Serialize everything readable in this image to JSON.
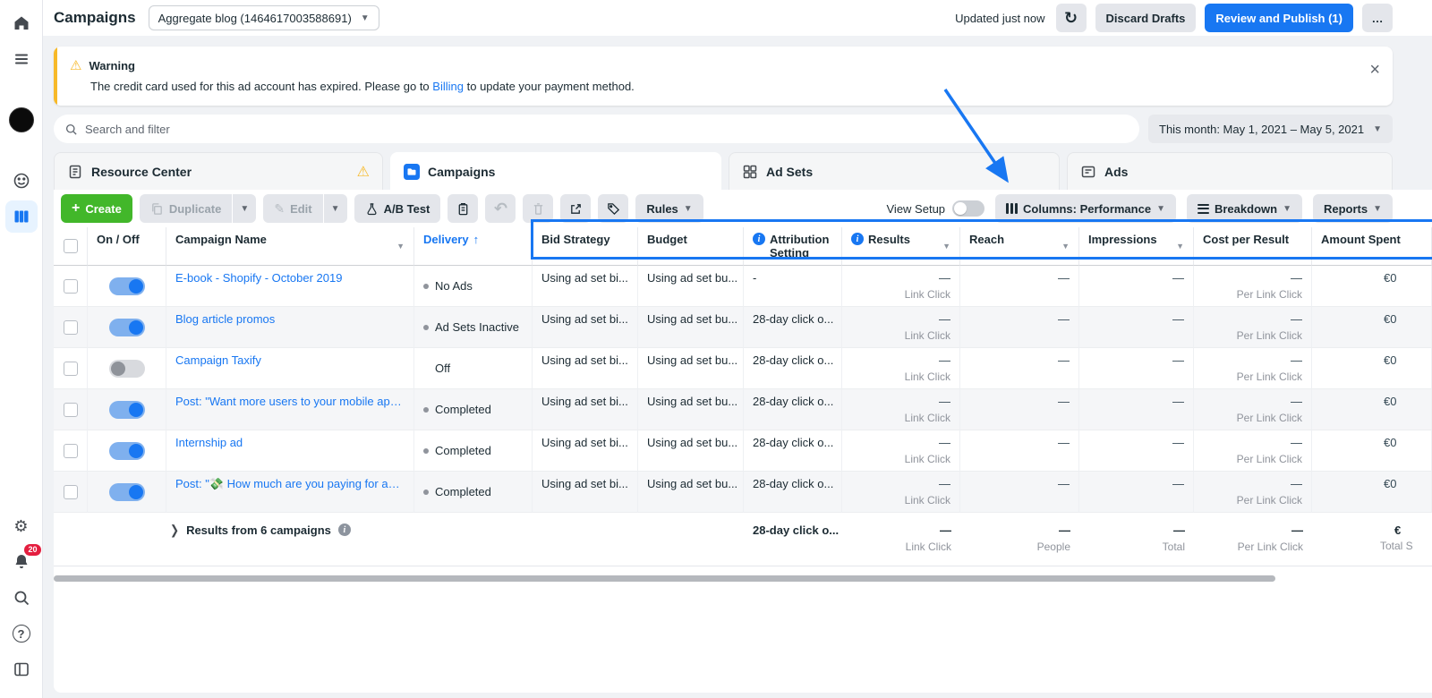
{
  "colors": {
    "accent_blue": "#1877f2",
    "create_green": "#42b72a",
    "warning_yellow": "#f7b928"
  },
  "sidebar": {
    "notification_count": "20"
  },
  "topbar": {
    "title": "Campaigns",
    "account_selector": "Aggregate blog (1464617003588691)",
    "updated_text": "Updated just now",
    "discard_label": "Discard Drafts",
    "review_label": "Review and Publish (1)",
    "more_label": "…"
  },
  "warning_banner": {
    "title": "Warning",
    "message_before_link": "The credit card used for this ad account has expired. Please go to",
    "link_text": "Billing",
    "message_after_link": "to update your payment method."
  },
  "filter_bar": {
    "search_placeholder": "Search and filter",
    "date_range": "This month: May 1, 2021 – May 5, 2021"
  },
  "tabs": {
    "resource_center": "Resource Center",
    "campaigns": "Campaigns",
    "ad_sets": "Ad Sets",
    "ads": "Ads"
  },
  "toolbar": {
    "create_label": "Create",
    "duplicate_label": "Duplicate",
    "edit_label": "Edit",
    "ab_test_label": "A/B Test",
    "rules_label": "Rules",
    "view_setup_label": "View Setup",
    "columns_label": "Columns: Performance",
    "breakdown_label": "Breakdown",
    "reports_label": "Reports"
  },
  "table": {
    "headers": {
      "on_off": "On / Off",
      "campaign_name": "Campaign Name",
      "delivery": "Delivery",
      "bid_strategy": "Bid Strategy",
      "budget": "Budget",
      "attribution": "Attribution Setting",
      "results": "Results",
      "reach": "Reach",
      "impressions": "Impressions",
      "cost_per_result": "Cost per Result",
      "amount_spent": "Amount Spent"
    },
    "rows": [
      {
        "on": true,
        "dot": true,
        "name": "E-book - Shopify - October 2019",
        "delivery": "No Ads",
        "bid": "Using ad set bi...",
        "budget": "Using ad set bu...",
        "attribution": "-",
        "results": "—",
        "results_sub": "Link Click",
        "reach": "—",
        "impressions": "—",
        "cpr": "—",
        "cpr_sub": "Per Link Click",
        "spent": "€0"
      },
      {
        "on": true,
        "dot": true,
        "name": "Blog article promos",
        "delivery": "Ad Sets Inactive",
        "bid": "Using ad set bi...",
        "budget": "Using ad set bu...",
        "attribution": "28-day click o...",
        "results": "—",
        "results_sub": "Link Click",
        "reach": "—",
        "impressions": "—",
        "cpr": "—",
        "cpr_sub": "Per Link Click",
        "spent": "€0"
      },
      {
        "on": false,
        "dot": false,
        "name": "Campaign Taxify",
        "delivery": "Off",
        "bid": "Using ad set bi...",
        "budget": "Using ad set bu...",
        "attribution": "28-day click o...",
        "results": "—",
        "results_sub": "Link Click",
        "reach": "—",
        "impressions": "—",
        "cpr": "—",
        "cpr_sub": "Per Link Click",
        "spent": "€0"
      },
      {
        "on": true,
        "dot": true,
        "name": "Post: \"Want more users to your mobile app?\"",
        "delivery": "Completed",
        "bid": "Using ad set bi...",
        "budget": "Using ad set bu...",
        "attribution": "28-day click o...",
        "results": "—",
        "results_sub": "Link Click",
        "reach": "—",
        "impressions": "—",
        "cpr": "—",
        "cpr_sub": "Per Link Click",
        "spent": "€0"
      },
      {
        "on": true,
        "dot": true,
        "name": "Internship ad",
        "delivery": "Completed",
        "bid": "Using ad set bi...",
        "budget": "Using ad set bu...",
        "attribution": "28-day click o...",
        "results": "—",
        "results_sub": "Link Click",
        "reach": "—",
        "impressions": "—",
        "cpr": "—",
        "cpr_sub": "Per Link Click",
        "spent": "€0"
      },
      {
        "on": true,
        "dot": true,
        "name": "Post: \"💸 How much are you paying for an Ins...",
        "delivery": "Completed",
        "bid": "Using ad set bi...",
        "budget": "Using ad set bu...",
        "attribution": "28-day click o...",
        "results": "—",
        "results_sub": "Link Click",
        "reach": "—",
        "impressions": "—",
        "cpr": "—",
        "cpr_sub": "Per Link Click",
        "spent": "€0"
      }
    ],
    "footer": {
      "label": "Results from 6 campaigns",
      "attribution": "28-day click o...",
      "results": "—",
      "results_sub": "Link Click",
      "reach": "—",
      "reach_sub": "People",
      "impressions": "—",
      "impressions_sub": "Total",
      "cpr": "—",
      "cpr_sub": "Per Link Click",
      "spent": "€",
      "spent_sub": "Total S"
    }
  }
}
